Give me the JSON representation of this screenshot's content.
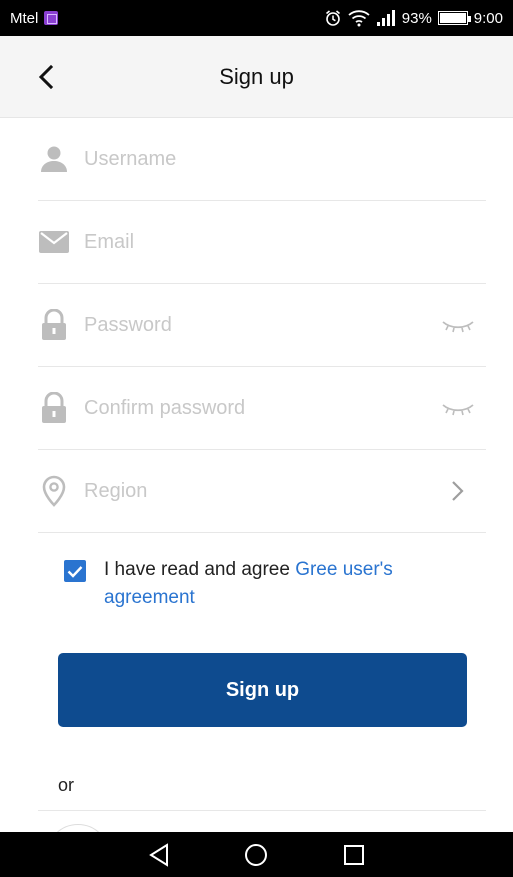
{
  "status_bar": {
    "carrier": "Mtel",
    "battery": "93%",
    "battery_level": 0.93,
    "time": "9:00",
    "icons": [
      "alarm-icon",
      "wifi-icon",
      "signal-icon",
      "battery-icon"
    ]
  },
  "header": {
    "title": "Sign up",
    "back_icon": "chevron-left-icon"
  },
  "form": {
    "username": {
      "placeholder": "Username",
      "value": "",
      "icon": "person-icon"
    },
    "email": {
      "placeholder": "Email",
      "value": "",
      "icon": "envelope-icon"
    },
    "password": {
      "placeholder": "Password",
      "value": "",
      "icon": "lock-icon",
      "trail_icon": "eye-closed-icon"
    },
    "confirm_password": {
      "placeholder": "Confirm password",
      "value": "",
      "icon": "lock-icon",
      "trail_icon": "eye-closed-icon"
    },
    "region": {
      "placeholder": "Region",
      "icon": "location-pin-icon",
      "trail_icon": "chevron-right-icon"
    }
  },
  "agreement": {
    "checked": true,
    "text": "I have read and agree ",
    "link": "Gree user's agreement"
  },
  "signup_button": {
    "label": "Sign up"
  },
  "alt": {
    "or_label": "or"
  },
  "colors": {
    "primary": "#0e4b8f",
    "link": "#2a74d0",
    "placeholder": "#c8c8c8",
    "header_bg": "#f5f5f5"
  },
  "nav_bar": {
    "icons": [
      "nav-back-icon",
      "nav-home-icon",
      "nav-recents-icon"
    ]
  }
}
